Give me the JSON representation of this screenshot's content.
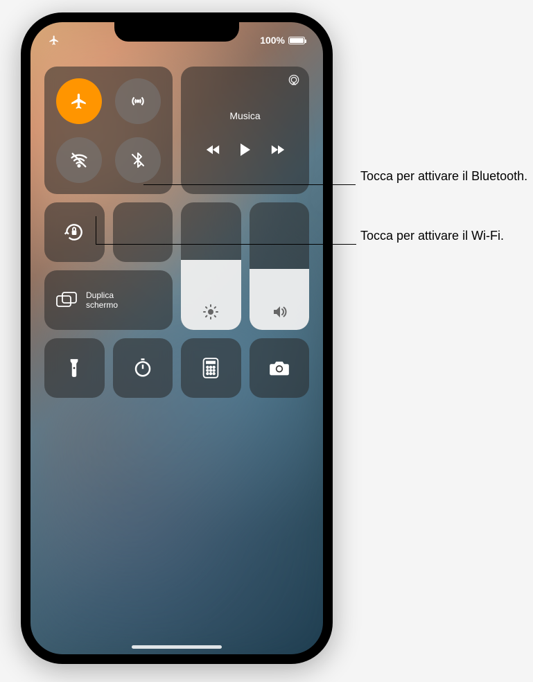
{
  "status": {
    "battery_text": "100%"
  },
  "connectivity": {
    "airplane_active": true
  },
  "music": {
    "label": "Musica"
  },
  "mirror": {
    "line1": "Duplica",
    "line2": "schermo"
  },
  "sliders": {
    "brightness_pct": 55,
    "volume_pct": 48
  },
  "callouts": {
    "bluetooth": "Tocca per attivare il Bluetooth.",
    "wifi": "Tocca per attivare il Wi-Fi."
  }
}
